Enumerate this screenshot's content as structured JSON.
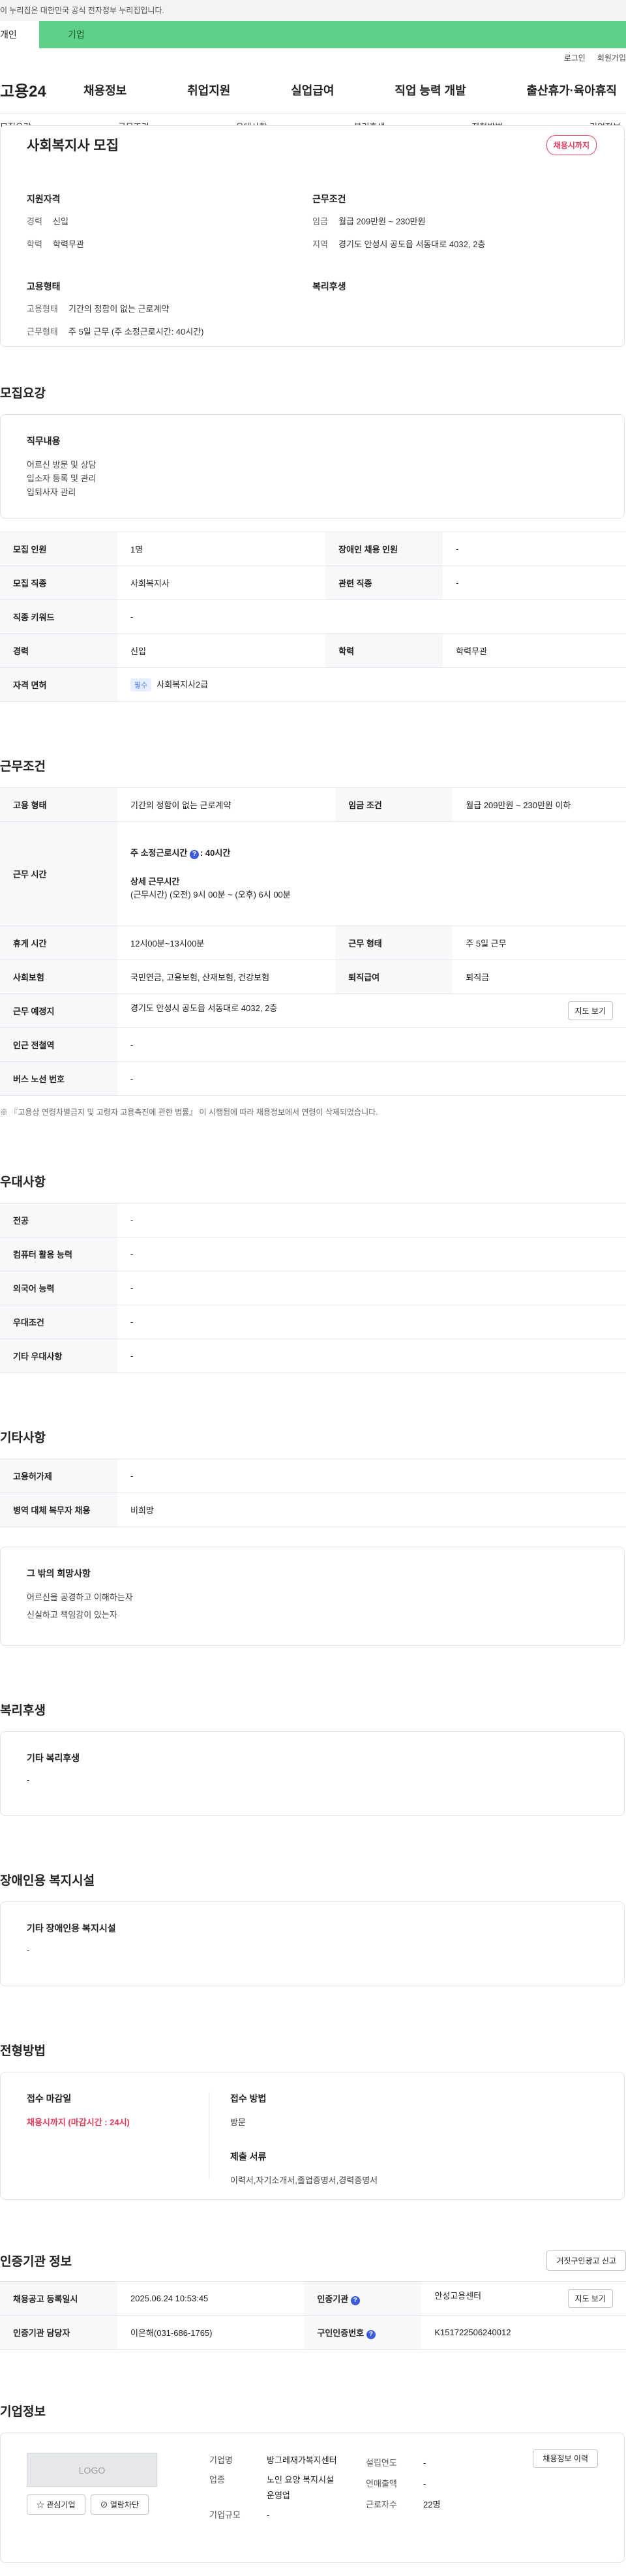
{
  "gov_banner": "이 누리집은 대한민국 공식 전자정부 누리집입니다.",
  "top_tabs": [
    "개인",
    "기업"
  ],
  "util_links": [
    "로그인",
    "회원가입"
  ],
  "logo": "고용24",
  "gnb": [
    "채용정보",
    "취업지원",
    "실업급여",
    "직업 능력 개발",
    "출산휴가·육아휴직"
  ],
  "subnav": [
    "모집요강",
    "근무조건",
    "우대사항",
    "복리후생",
    "전형방법",
    "기업정보"
  ],
  "summary": {
    "title": "사회복지사 모집",
    "badge": "채용시까지",
    "qual_head": "지원자격",
    "career_k": "경력",
    "career_v": "신입",
    "edu_k": "학력",
    "edu_v": "학력무관",
    "cond_head": "근무조건",
    "pay_k": "임금",
    "pay_v": "월급 209만원 ~ 230만원",
    "loc_k": "지역",
    "loc_v": "경기도 안성시 공도읍 서동대로 4032, 2층",
    "emp_head": "고용형태",
    "emp_k1": "고용형태",
    "emp_v1": "기간의 정함이 없는 근로계약",
    "emp_k2": "근무형태",
    "emp_v2": "주 5일 근무 (주 소정근로시간: 40시간)",
    "welfare_head": "복리후생"
  },
  "recruit": {
    "title": "모집요강",
    "duty_head": "직무내용",
    "duties": [
      "어르신 방문 및 상담",
      "입소자 등록 및 관리",
      "입퇴사자 관리"
    ],
    "rows": {
      "count_k": "모집 인원",
      "count_v": "1명",
      "disabled_k": "장애인 채용 인원",
      "disabled_v": "-",
      "job_k": "모집 직종",
      "job_v": "사회복지사",
      "rel_k": "관련 직종",
      "rel_v": "-",
      "kw_k": "직종 키워드",
      "kw_v": "-",
      "career_k": "경력",
      "career_v": "신입",
      "edu_k": "학력",
      "edu_v": "학력무관",
      "lic_k": "자격 면허",
      "lic_pill": "필수",
      "lic_v": "사회복지사2급"
    }
  },
  "conditions": {
    "title": "근무조건",
    "emp_k": "고용 형태",
    "emp_v": "기간의 정함이 없는 근로계약",
    "pay_k": "임금 조건",
    "pay_v": "월급 209만원 ~ 230만원 이하",
    "hours_k": "근무 시간",
    "hours_main": "주 소정근로시간",
    "hours_val": ": 40시간",
    "hours_detail_h": "상세 근무시간",
    "hours_detail": "(근무시간) (오전) 9시 00분 ~ (오후) 6시 00분",
    "rest_k": "휴게 시간",
    "rest_v": "12시00분~13시00분",
    "type_k": "근무 형태",
    "type_v": "주 5일 근무",
    "ins_k": "사회보험",
    "ins_v": "국민연금, 고용보험, 산재보험, 건강보험",
    "sev_k": "퇴직급여",
    "sev_v": "퇴직금",
    "place_k": "근무 예정지",
    "place_v": "경기도 안성시 공도읍 서동대로 4032, 2층",
    "map_btn": "지도 보기",
    "subway_k": "인근 전철역",
    "subway_v": "-",
    "bus_k": "버스 노선 번호",
    "bus_v": "-",
    "note": "※ 『고용상 연령차별금지 및 고령자 고용촉진에 관한 법률』 이 시행됨에 따라 채용정보에서 연령이 삭제되었습니다."
  },
  "pref": {
    "title": "우대사항",
    "rows": [
      {
        "k": "전공",
        "v": "-"
      },
      {
        "k": "컴퓨터 활용 능력",
        "v": "-"
      },
      {
        "k": "외국어 능력",
        "v": "-"
      },
      {
        "k": "우대조건",
        "v": "-"
      },
      {
        "k": "기타 우대사항",
        "v": "-"
      }
    ]
  },
  "etc": {
    "title": "기타사항",
    "rows": [
      {
        "k": "고용허가제",
        "v": "-"
      },
      {
        "k": "병역 대체 복무자 채용",
        "v": "비희망"
      }
    ],
    "talent_head": "그 밖의 희망사항",
    "talents": [
      "어르신을 공경하고 이해하는자",
      "신실하고 책임감이 있는자"
    ]
  },
  "welfare": {
    "title": "복리후생",
    "head": "기타 복리후생",
    "v": "-"
  },
  "facility": {
    "title": "장애인용 복지시설",
    "head": "기타 장애인용 복지시설",
    "v": "-"
  },
  "process": {
    "title": "전형방법",
    "deadline_h": "접수 마감일",
    "deadline_v": "채용시까지 (마감시간 : 24시)",
    "method_h": "접수 방법",
    "method_v": "방문",
    "docs_h": "제출 서류",
    "docs_v": "이력서,자기소개서,졸업증명서,경력증명서"
  },
  "agency": {
    "title": "인증기관 정보",
    "report_btn": "거짓구인광고 신고",
    "reg_k": "채용공고 등록일시",
    "reg_v": "2025.06.24 10:53:45",
    "org_k": "인증기관",
    "org_v": "안성고용센터",
    "map_btn": "지도 보기",
    "mgr_k": "인증기관 담당자",
    "mgr_v": "이은해(031-686-1765)",
    "id_k": "구인인증번호",
    "id_v": "K151722506240012"
  },
  "company": {
    "title": "기업정보",
    "logo": "LOGO",
    "fav_btn": "관심기업",
    "block_btn": "열람차단",
    "history_btn": "채용정보 이력",
    "name_k": "기업명",
    "name_v": "방그레재가복지센터",
    "ind_k": "업종",
    "ind_v": "노인 요양 복지시설 운영업",
    "size_k": "기업규모",
    "size_v": "-",
    "year_k": "설립연도",
    "year_v": "-",
    "sales_k": "연매출액",
    "sales_v": "-",
    "emp_k": "근로자수",
    "emp_v": "22명"
  }
}
